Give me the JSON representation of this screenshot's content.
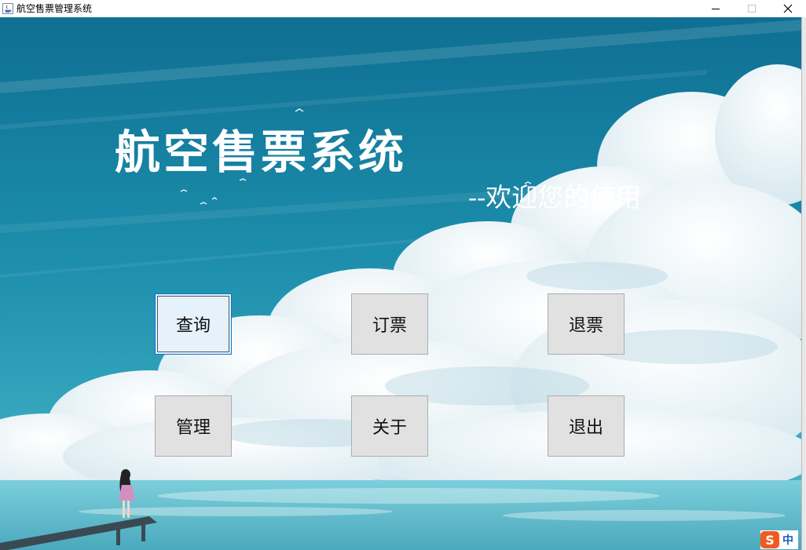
{
  "window": {
    "title": "航空售票管理系统",
    "controls": [
      "minimize",
      "maximize",
      "close"
    ]
  },
  "header": {
    "title": "航空售票系统",
    "subtitle": "--欢迎您的使用"
  },
  "menu": {
    "query": "查询",
    "book": "订票",
    "refund": "退票",
    "manage": "管理",
    "about": "关于",
    "exit": "退出"
  },
  "ime": {
    "logo": "S",
    "mode": "中"
  },
  "colors": {
    "sky_top": "#1a7e9d",
    "sky_mid": "#2d9fb8",
    "sea": "#5fbfcf",
    "button_face": "#e1e1e1",
    "button_border": "#adadad",
    "focus_border": "#0078d7",
    "text_white": "#ffffff",
    "ime_brand": "#f05a22"
  }
}
